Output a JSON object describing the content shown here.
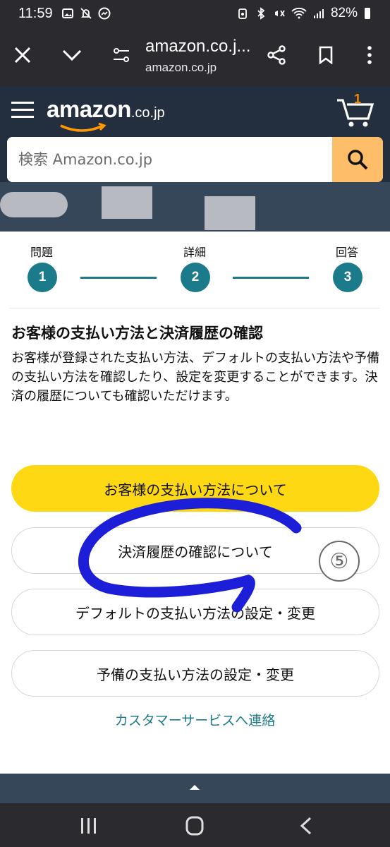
{
  "status_bar": {
    "time": "11:59",
    "battery": "82%",
    "icons": [
      "image-icon",
      "mute-notification-icon",
      "messenger-icon",
      "alarm-icon",
      "bluetooth-icon",
      "vibrate-icon",
      "wifi-icon",
      "signal-icon",
      "battery-icon"
    ]
  },
  "browser": {
    "url_title": "amazon.co.j...",
    "url_sub": "amazon.co.jp",
    "icons": [
      "close-icon",
      "chevron-down-icon",
      "site-settings-icon",
      "share-icon",
      "bookmark-icon",
      "more-icon"
    ]
  },
  "header": {
    "logo_word": "amazon",
    "logo_domain": ".co.jp",
    "cart_count": "1",
    "search_placeholder": "検索 Amazon.co.jp"
  },
  "stepper": {
    "steps": [
      {
        "label": "問題",
        "number": "1"
      },
      {
        "label": "詳細",
        "number": "2"
      },
      {
        "label": "回答",
        "number": "3"
      }
    ]
  },
  "content": {
    "title": "お客様の支払い方法と決済履歴の確認",
    "description": "お客様が登録された支払い方法、デフォルトの支払い方法や予備の支払い方法を確認したり、設定を変更することができます。決済の履歴についても確認いただけます。",
    "buttons": [
      "お客様の支払い方法について",
      "決済履歴の確認について",
      "デフォルトの支払い方法の設定・変更",
      "予備の支払い方法の設定・変更"
    ],
    "link": "カスタマーサービスへ連絡",
    "annotation_number": "⑤"
  },
  "colors": {
    "amazon_dark": "#232f3e",
    "amazon_yellow": "#ffd814",
    "search_orange": "#febd69",
    "teal": "#1b7b8a",
    "annotation_blue": "#1d1fd8"
  }
}
